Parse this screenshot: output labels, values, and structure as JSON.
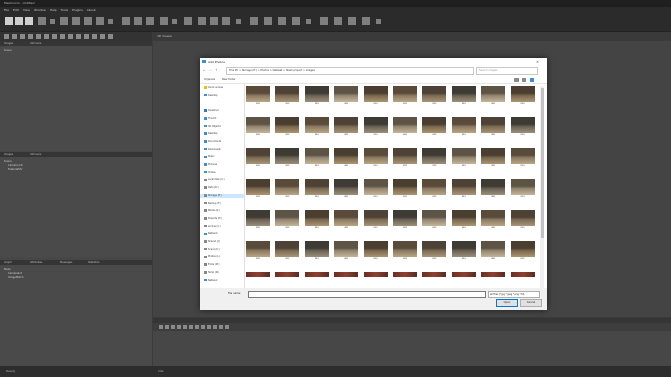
{
  "app": {
    "title": "Meshroom - Untitled",
    "menu": [
      "File",
      "Edit",
      "View",
      "Window",
      "Help",
      "Tools",
      "Plugins",
      "About"
    ]
  },
  "left_panel": {
    "tabs1": [
      "Images",
      "Intrinsics"
    ],
    "section1": "Scene",
    "tabs2": [
      "Images",
      "Intrinsics"
    ],
    "section2": "Scene",
    "items2": [
      "Camera Init",
      "FeatureExtr"
    ],
    "tabs3": [
      "Graph",
      "Attributes",
      "Messages",
      "Statistics"
    ],
    "section3": "Node",
    "items3": [
      "CameraInit",
      "ImageMatch"
    ]
  },
  "viewer": {
    "header": "3D Viewer"
  },
  "statusbar": {
    "left": "Ready",
    "right": "Idle"
  },
  "dialog": {
    "title": "Add Photos",
    "address": "This PC  >  Storage (E:)  >  Photos  >  Dataset  >  Mesh project  >  images",
    "search_placeholder": "Search images",
    "commands": [
      "Organize",
      "New folder"
    ],
    "nav": [
      {
        "label": "Quick access",
        "color": "#f0c000"
      },
      {
        "label": "Desktop",
        "color": "#3b8ed8"
      },
      {
        "label": "",
        "color": ""
      },
      {
        "label": "OneDrive",
        "color": "#2a78d6"
      },
      {
        "label": "This PC",
        "color": "#3b8ed8"
      },
      {
        "label": "3D Objects",
        "color": "#3b8ed8"
      },
      {
        "label": "Desktop",
        "color": "#3b8ed8"
      },
      {
        "label": "Documents",
        "color": "#3b8ed8"
      },
      {
        "label": "Downloads",
        "color": "#3b8ed8"
      },
      {
        "label": "Music",
        "color": "#3b8ed8"
      },
      {
        "label": "Pictures",
        "color": "#3b8ed8"
      },
      {
        "label": "Videos",
        "color": "#3b8ed8"
      },
      {
        "label": "Local Disk (C:)",
        "color": "#888888"
      },
      {
        "label": "Data (D:)",
        "color": "#888888"
      },
      {
        "label": "Storage (E:)",
        "color": "#888888",
        "selected": true
      },
      {
        "label": "Backup (F:)",
        "color": "#888888"
      },
      {
        "label": "Media (G:)",
        "color": "#888888"
      },
      {
        "label": "Projects (H:)",
        "color": "#888888"
      },
      {
        "label": "Archive (I:)",
        "color": "#888888"
      },
      {
        "label": "Network",
        "color": "#3b8ed8"
      },
      {
        "label": "Shared (J:)",
        "color": "#888888"
      },
      {
        "label": "Scans (K:)",
        "color": "#888888"
      },
      {
        "label": "Photos (L:)",
        "color": "#888888"
      },
      {
        "label": "Extra (M:)",
        "color": "#888888"
      },
      {
        "label": "Temp (N:)",
        "color": "#888888"
      },
      {
        "label": "Network",
        "color": "#3b8ed8"
      }
    ],
    "thumb_caption": "IMG",
    "file_name_label": "File name:",
    "file_type": "All Files (*.jpg *.jpeg *.png *.tif)",
    "open_label": "Open",
    "cancel_label": "Cancel"
  }
}
